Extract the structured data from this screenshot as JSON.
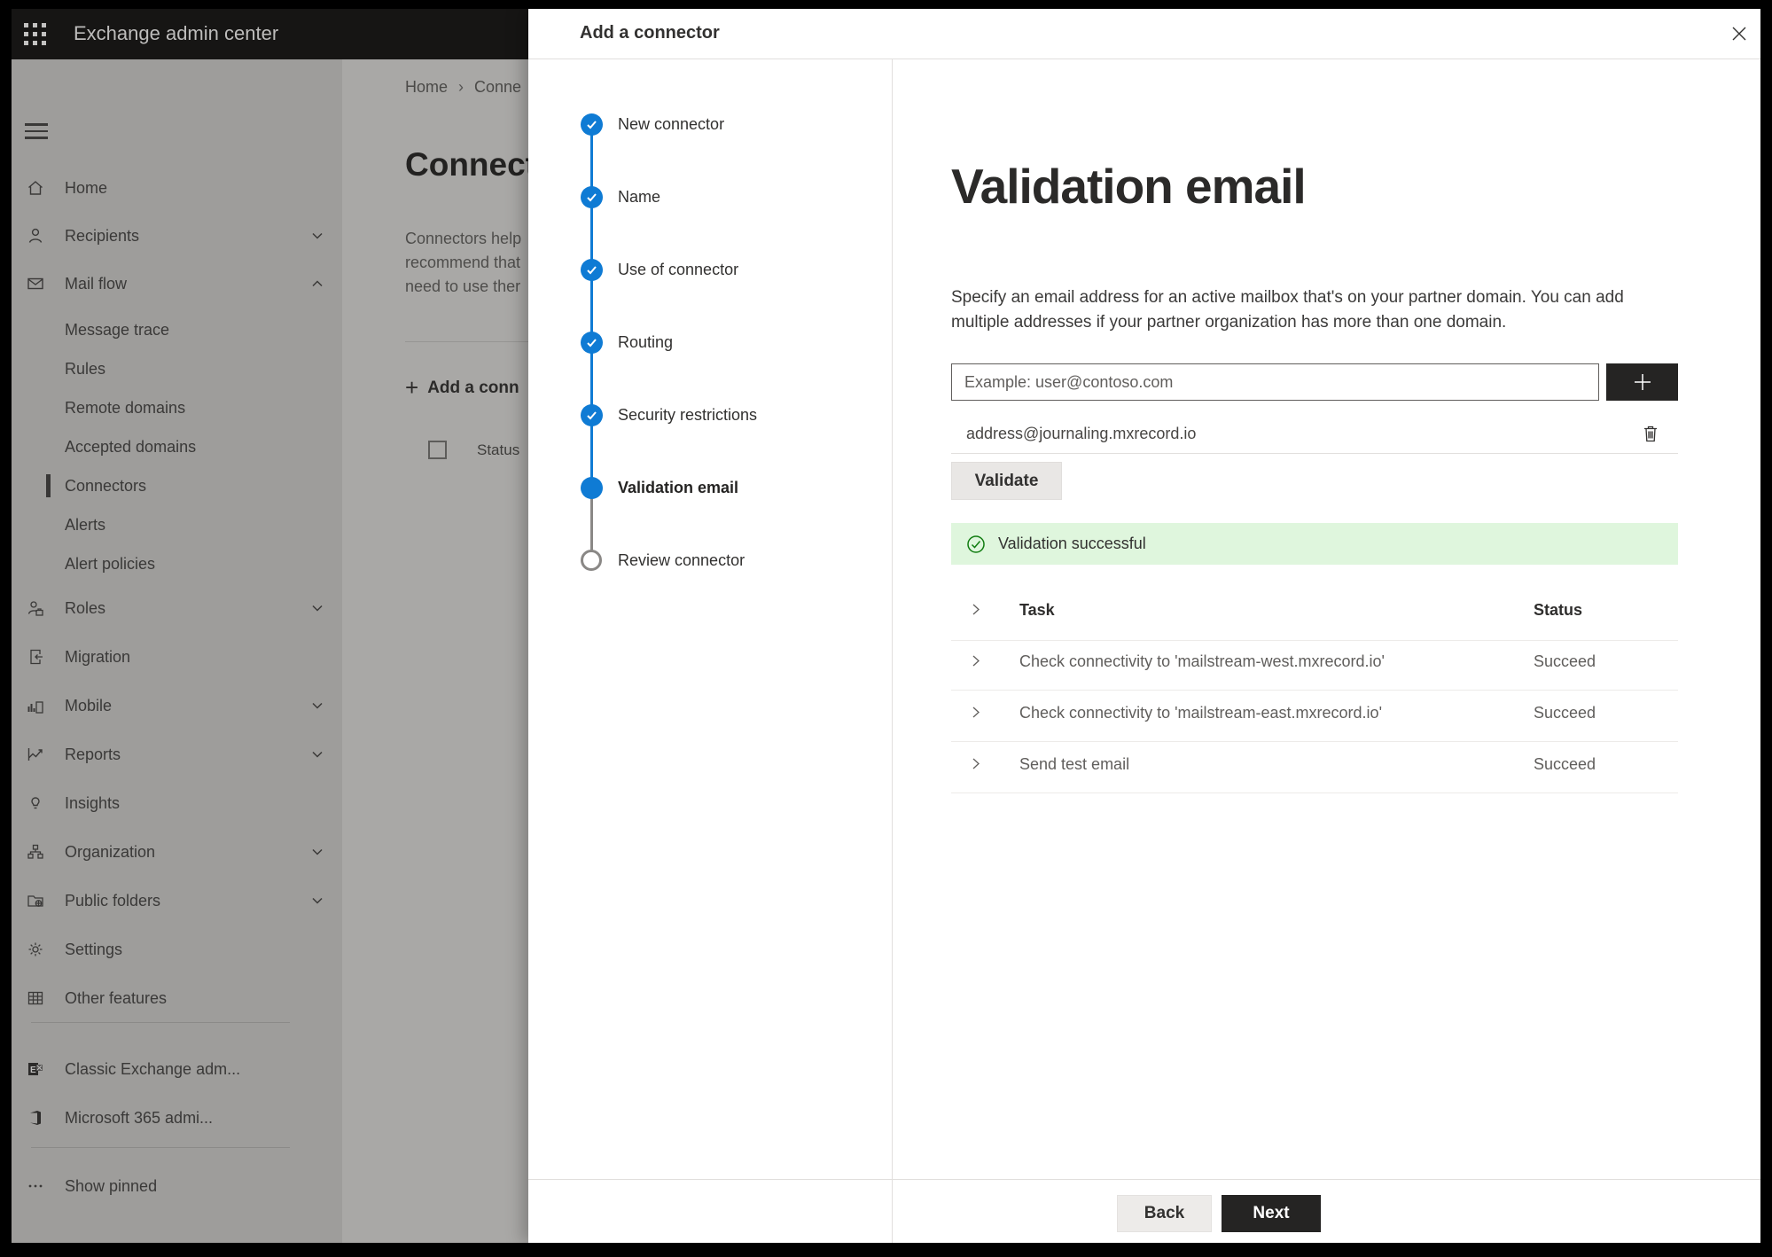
{
  "topbar": {
    "title": "Exchange admin center"
  },
  "background_page": {
    "breadcrumb": {
      "home": "Home",
      "separator": "›",
      "current": "Conne"
    },
    "page_title": "Connect",
    "intro_lines": [
      "Connectors help",
      "recommend that",
      "need to use ther"
    ],
    "add_connector_label": "Add a conn",
    "plus_glyph": "+",
    "status_header": "Status"
  },
  "sidebar": {
    "items": [
      {
        "label": "Home"
      },
      {
        "label": "Recipients"
      },
      {
        "label": "Mail flow"
      },
      {
        "label": "Message trace"
      },
      {
        "label": "Rules"
      },
      {
        "label": "Remote domains"
      },
      {
        "label": "Accepted domains"
      },
      {
        "label": "Connectors",
        "selected": true
      },
      {
        "label": "Alerts"
      },
      {
        "label": "Alert policies"
      },
      {
        "label": "Roles"
      },
      {
        "label": "Migration"
      },
      {
        "label": "Mobile"
      },
      {
        "label": "Reports"
      },
      {
        "label": "Insights"
      },
      {
        "label": "Organization"
      },
      {
        "label": "Public folders"
      },
      {
        "label": "Settings"
      },
      {
        "label": "Other features"
      },
      {
        "label": "Classic Exchange adm..."
      },
      {
        "label": "Microsoft 365 admi..."
      },
      {
        "label": "Show pinned"
      }
    ]
  },
  "panel": {
    "title": "Add a connector",
    "steps": [
      {
        "label": "New connector",
        "state": "completed"
      },
      {
        "label": "Name",
        "state": "completed"
      },
      {
        "label": "Use of connector",
        "state": "completed"
      },
      {
        "label": "Routing",
        "state": "completed"
      },
      {
        "label": "Security restrictions",
        "state": "completed"
      },
      {
        "label": "Validation email",
        "state": "current"
      },
      {
        "label": "Review connector",
        "state": "upcoming"
      }
    ],
    "content": {
      "heading": "Validation email",
      "description": "Specify an email address for an active mailbox that's on your partner domain. You can add multiple addresses if your partner organization has more than one domain.",
      "email_input": {
        "value": "",
        "placeholder": "Example: user@contoso.com"
      },
      "added_address": "address@journaling.mxrecord.io",
      "validate_label": "Validate",
      "banner": {
        "text": "Validation successful"
      },
      "table": {
        "headers": {
          "task": "Task",
          "status": "Status"
        },
        "rows": [
          {
            "task": "Check connectivity to 'mailstream-west.mxrecord.io'",
            "status": "Succeed"
          },
          {
            "task": "Check connectivity to 'mailstream-east.mxrecord.io'",
            "status": "Succeed"
          },
          {
            "task": "Send test email",
            "status": "Succeed"
          }
        ]
      },
      "back_label": "Back",
      "next_label": "Next"
    }
  },
  "colors": {
    "accent_blue": "#0f7bd4",
    "success_green": "#107c10",
    "success_banner_bg": "#dff6dd",
    "button_dark": "#252423"
  }
}
